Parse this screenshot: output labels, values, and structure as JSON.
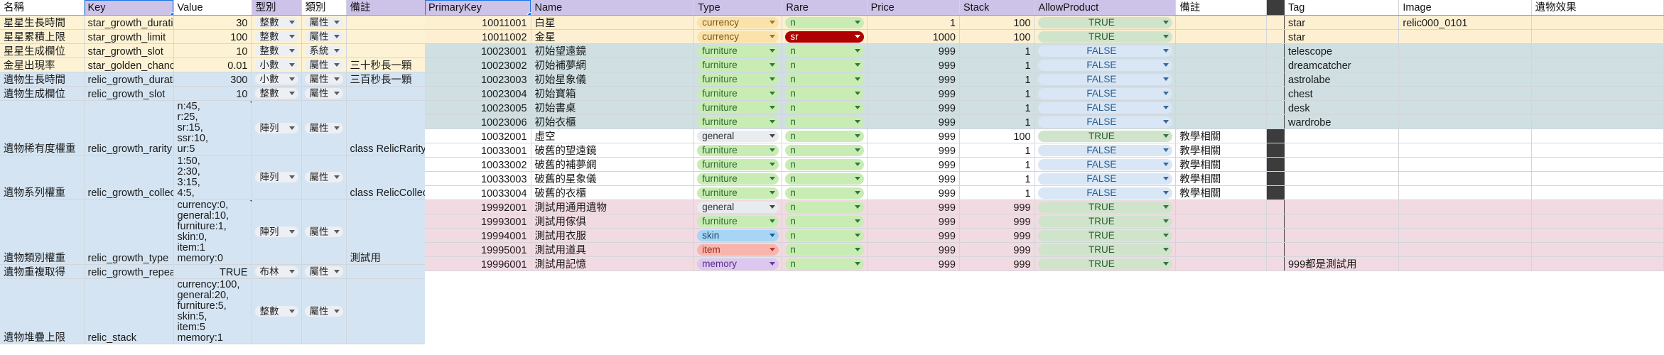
{
  "left_sheet": {
    "columns": [
      "名稱",
      "Key",
      "Value",
      "型別",
      "類別",
      "備註"
    ],
    "rows": [
      {
        "name": "星星生長時間",
        "key": "star_growth_duration",
        "value": "30",
        "value_align": "right",
        "type": "整數",
        "category": "屬性",
        "note": "",
        "band": "cream"
      },
      {
        "name": "星星累積上限",
        "key": "star_growth_limit",
        "value": "100",
        "value_align": "right",
        "type": "整數",
        "category": "屬性",
        "note": "",
        "band": "cream"
      },
      {
        "name": "星星生成欄位",
        "key": "star_growth_slot",
        "value": "10",
        "value_align": "right",
        "type": "整數",
        "category": "系統",
        "note": "",
        "band": "cream"
      },
      {
        "name": "金星出現率",
        "key": "star_golden_chance",
        "value": "0.01",
        "value_align": "right",
        "type": "小數",
        "category": "屬性",
        "note": "三十秒長一顆",
        "band": "cream"
      },
      {
        "name": "遺物生長時間",
        "key": "relic_growth_duration",
        "value": "300",
        "value_align": "right",
        "type": "小數",
        "category": "屬性",
        "note": "三百秒長一顆",
        "band": "blue"
      },
      {
        "name": "遺物生成欄位",
        "key": "relic_growth_slot",
        "value": "10",
        "value_align": "right",
        "type": "整數",
        "category": "屬性",
        "note": "",
        "band": "blue"
      },
      {
        "name": "遺物稀有度權重",
        "key": "relic_growth_rarity",
        "value": "n:45,\nr:25,\nsr:15,\nssr:10,\nur:5",
        "value_align": "left",
        "type": "陣列",
        "category": "屬性",
        "note": "class RelicRarityWeight",
        "band": "blue",
        "tall": true,
        "flag": true
      },
      {
        "name": "遺物系列權重",
        "key": "relic_growth_collection",
        "value": "1:50,\n2:30,\n3:15,\n4:5,",
        "value_align": "left",
        "type": "陣列",
        "category": "屬性",
        "note": "class RelicCollectionWeight",
        "band": "blue",
        "tall": true
      },
      {
        "name": "遺物類別權重",
        "key": "relic_growth_type",
        "value": "currency:0,\ngeneral:10,\nfurniture:1,\nskin:0,\nitem:1\nmemory:0",
        "value_align": "left",
        "type": "陣列",
        "category": "屬性",
        "note": "測試用",
        "band": "blue",
        "tall": true,
        "flag": true
      },
      {
        "name": "遺物重複取得",
        "key": "relic_growth_repeat",
        "value": "TRUE",
        "value_align": "right",
        "type": "布林",
        "category": "屬性",
        "note": "",
        "band": "blue"
      },
      {
        "name": "遺物堆疊上限",
        "key": "relic_stack",
        "value": "currency:100,\ngeneral:20,\nfurniture:5,\nskin:5,\nitem:5\nmemory:1",
        "value_align": "left",
        "type": "整數",
        "category": "屬性",
        "note": "",
        "band": "blue",
        "tall": true
      }
    ]
  },
  "right_sheet": {
    "columns": [
      "PrimaryKey",
      "Name",
      "Type",
      "Rare",
      "Price",
      "Stack",
      "AllowProduct",
      "備註",
      "",
      "Tag",
      "Image",
      "遺物效果"
    ],
    "selected_header": "PrimaryKey",
    "rows": [
      {
        "pk": "10011001",
        "name": "白星",
        "type": "currency",
        "rare": "n",
        "price": "1",
        "stack": "100",
        "allow": "TRUE",
        "note": "",
        "tag": "star",
        "image": "relic000_0101",
        "effect": "",
        "band": "cream"
      },
      {
        "pk": "10011002",
        "name": "金星",
        "type": "currency",
        "rare": "sr",
        "price": "1000",
        "stack": "100",
        "allow": "TRUE",
        "note": "",
        "tag": "star",
        "image": "",
        "effect": "",
        "band": "cream"
      },
      {
        "pk": "10023001",
        "name": "初始望遠鏡",
        "type": "furniture",
        "rare": "n",
        "price": "999",
        "stack": "1",
        "allow": "FALSE",
        "note": "",
        "tag": "telescope",
        "image": "",
        "effect": "",
        "band": "steel"
      },
      {
        "pk": "10023002",
        "name": "初始補夢網",
        "type": "furniture",
        "rare": "n",
        "price": "999",
        "stack": "1",
        "allow": "FALSE",
        "note": "",
        "tag": "dreamcatcher",
        "image": "",
        "effect": "",
        "band": "steel"
      },
      {
        "pk": "10023003",
        "name": "初始星象儀",
        "type": "furniture",
        "rare": "n",
        "price": "999",
        "stack": "1",
        "allow": "FALSE",
        "note": "",
        "tag": "astrolabe",
        "image": "",
        "effect": "",
        "band": "steel"
      },
      {
        "pk": "10023004",
        "name": "初始寶箱",
        "type": "furniture",
        "rare": "n",
        "price": "999",
        "stack": "1",
        "allow": "FALSE",
        "note": "",
        "tag": "chest",
        "image": "",
        "effect": "",
        "band": "steel"
      },
      {
        "pk": "10023005",
        "name": "初始書桌",
        "type": "furniture",
        "rare": "n",
        "price": "999",
        "stack": "1",
        "allow": "FALSE",
        "note": "",
        "tag": "desk",
        "image": "",
        "effect": "",
        "band": "steel"
      },
      {
        "pk": "10023006",
        "name": "初始衣櫃",
        "type": "furniture",
        "rare": "n",
        "price": "999",
        "stack": "1",
        "allow": "FALSE",
        "note": "",
        "tag": "wardrobe",
        "image": "",
        "effect": "",
        "band": "steel"
      },
      {
        "pk": "10032001",
        "name": "虛空",
        "type": "general",
        "rare": "n",
        "price": "999",
        "stack": "100",
        "allow": "TRUE",
        "note": "教學相關",
        "tag": "",
        "image": "",
        "effect": "",
        "band": "plain"
      },
      {
        "pk": "10033001",
        "name": "破舊的望遠鏡",
        "type": "furniture",
        "rare": "n",
        "price": "999",
        "stack": "1",
        "allow": "FALSE",
        "note": "教學相關",
        "tag": "",
        "image": "",
        "effect": "",
        "band": "plain"
      },
      {
        "pk": "10033002",
        "name": "破舊的補夢網",
        "type": "furniture",
        "rare": "n",
        "price": "999",
        "stack": "1",
        "allow": "FALSE",
        "note": "教學相關",
        "tag": "",
        "image": "",
        "effect": "",
        "band": "plain"
      },
      {
        "pk": "10033003",
        "name": "破舊的星象儀",
        "type": "furniture",
        "rare": "n",
        "price": "999",
        "stack": "1",
        "allow": "FALSE",
        "note": "教學相關",
        "tag": "",
        "image": "",
        "effect": "",
        "band": "plain"
      },
      {
        "pk": "10033004",
        "name": "破舊的衣櫃",
        "type": "furniture",
        "rare": "n",
        "price": "999",
        "stack": "1",
        "allow": "FALSE",
        "note": "教學相關",
        "tag": "",
        "image": "",
        "effect": "",
        "band": "plain"
      },
      {
        "pk": "19992001",
        "name": "測試用通用遺物",
        "type": "general",
        "rare": "n",
        "price": "999",
        "stack": "999",
        "allow": "TRUE",
        "note": "",
        "tag": "",
        "image": "",
        "effect": "",
        "band": "pink"
      },
      {
        "pk": "19993001",
        "name": "測試用傢俱",
        "type": "furniture",
        "rare": "n",
        "price": "999",
        "stack": "999",
        "allow": "TRUE",
        "note": "",
        "tag": "",
        "image": "",
        "effect": "",
        "band": "pink"
      },
      {
        "pk": "19994001",
        "name": "測試用衣服",
        "type": "skin",
        "rare": "n",
        "price": "999",
        "stack": "999",
        "allow": "TRUE",
        "note": "",
        "tag": "",
        "image": "",
        "effect": "",
        "band": "pink"
      },
      {
        "pk": "19995001",
        "name": "測試用道具",
        "type": "item",
        "rare": "n",
        "price": "999",
        "stack": "999",
        "allow": "TRUE",
        "note": "",
        "tag": "",
        "image": "",
        "effect": "",
        "band": "pink"
      },
      {
        "pk": "19996001",
        "name": "測試用記憶",
        "type": "memory",
        "rare": "n",
        "price": "999",
        "stack": "999",
        "allow": "TRUE",
        "note": "",
        "tag": "999都是測試用",
        "image": "",
        "effect": "",
        "band": "pink"
      }
    ]
  }
}
